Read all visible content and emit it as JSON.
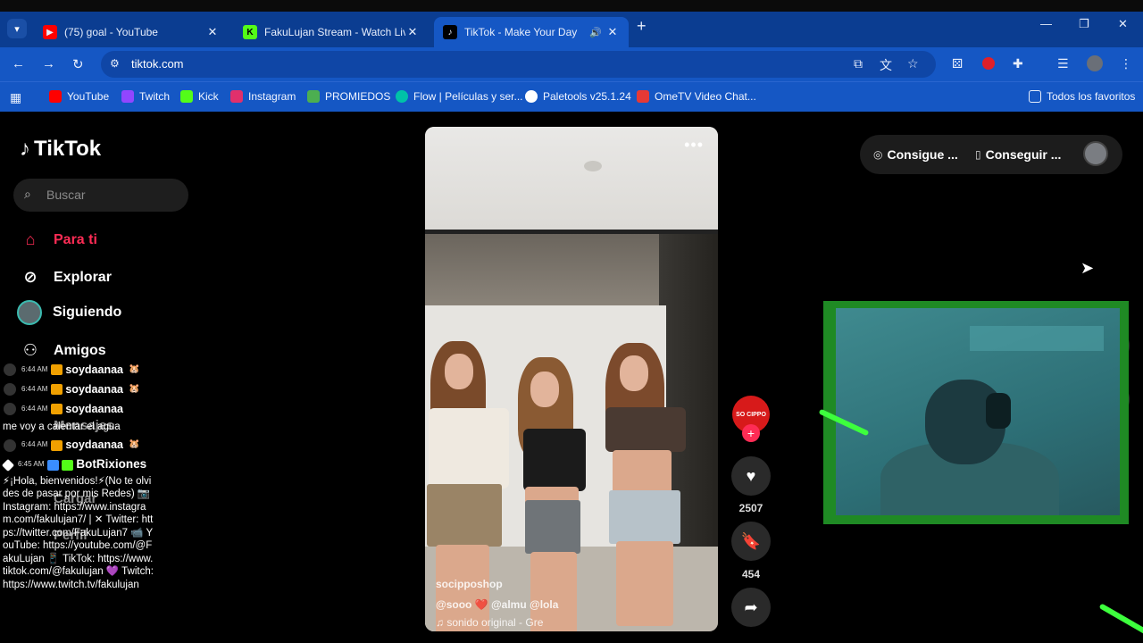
{
  "browser": {
    "tabs": [
      {
        "title": "(75) goal - YouTube",
        "favicon_color": "#ff0000",
        "favicon": "▶"
      },
      {
        "title": "FakuLujan Stream - Watch Live",
        "favicon_color": "#53fc18",
        "favicon": "K"
      },
      {
        "title": "TikTok - Make Your Day",
        "favicon_color": "#000000",
        "favicon": "♪"
      }
    ],
    "url": "tiktok.com",
    "bookmarks": [
      {
        "label": "YouTube",
        "color": "#ff0000"
      },
      {
        "label": "Twitch",
        "color": "#9146ff"
      },
      {
        "label": "Kick",
        "color": "#53fc18"
      },
      {
        "label": "Instagram",
        "color": "#e1306c"
      },
      {
        "label": "PROMIEDOS",
        "color": "#4caf50"
      },
      {
        "label": "Flow | Películas y ser...",
        "color": "#00c2a8"
      },
      {
        "label": "Paletools v25.1.24",
        "color": "#ffffff"
      },
      {
        "label": "OmeTV Video Chat...",
        "color": "#e53935"
      }
    ],
    "all_bookmarks": "Todos los favoritos"
  },
  "tiktok": {
    "logo": "TikTok",
    "search_placeholder": "Buscar",
    "nav": [
      {
        "label": "Para ti",
        "icon": "home-icon"
      },
      {
        "label": "Explorar",
        "icon": "compass-icon"
      },
      {
        "label": "Siguiendo",
        "icon": "following-avatar"
      },
      {
        "label": "Amigos",
        "icon": "friends-icon"
      }
    ],
    "ghost_nav": [
      "Mensajes",
      "Cargar",
      "Perfil"
    ],
    "video": {
      "shop": "socipposhop",
      "tags": "@sooo ❤️ @almu @lola",
      "sound": "♫ sonido original - Gre",
      "author_badge": "SO CIPPO"
    },
    "actions": {
      "likes": "2507",
      "saves": "454"
    },
    "top_right": {
      "btn1": "Consigue ...",
      "btn2": "Conseguir ..."
    }
  },
  "chat": {
    "rows": [
      {
        "time": "6:44 AM",
        "user": "soydaanaa",
        "emote": "🐹"
      },
      {
        "time": "6:44 AM",
        "user": "soydaanaa",
        "emote": "🐹"
      },
      {
        "time": "6:44 AM",
        "user": "soydaanaa",
        "emote": ""
      }
    ],
    "message1": "me voy a calentar el agua",
    "row4": {
      "time": "6:44 AM",
      "user": "soydaanaa",
      "emote": "🐹"
    },
    "bot": {
      "time": "6:45 AM",
      "user": "BotRixiones"
    },
    "bot_message": "⚡¡Hola, bienvenidos!⚡(No te olvides de pasar por mis Redes) 📷 Instagram: https://www.instagram.com/fakulujan7/ | ✕ Twitter: https://twitter.com/FakuLujan7 📹 YouTube: https://youtube.com/@FakuLujan 📱 TikTok: https://www.tiktok.com/@fakulujan 💜 Twitch: https://www.twitch.tv/fakulujan"
  }
}
